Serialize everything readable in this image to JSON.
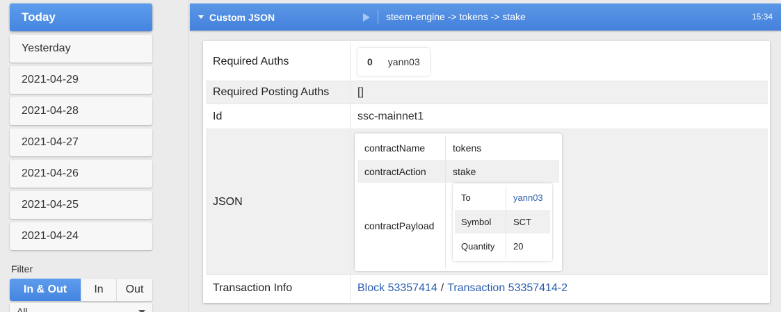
{
  "sidebar": {
    "dates": [
      "Today",
      "Yesterday",
      "2021-04-29",
      "2021-04-28",
      "2021-04-27",
      "2021-04-26",
      "2021-04-25",
      "2021-04-24"
    ],
    "filter_label": "Filter",
    "filter_options": [
      "In & Out",
      "In",
      "Out"
    ],
    "select_value": "All"
  },
  "header": {
    "title": "Custom JSON",
    "path": "steem-engine -> tokens -> stake",
    "time": "15:34"
  },
  "details": {
    "required_auths_label": "Required Auths",
    "required_auths_index": "0",
    "required_auths_value": "yann03",
    "required_posting_label": "Required Posting Auths",
    "required_posting_value": "[]",
    "id_label": "Id",
    "id_value": "ssc-mainnet1",
    "json_label": "JSON",
    "json": {
      "contract_name_key": "contractName",
      "contract_name_value": "tokens",
      "contract_action_key": "contractAction",
      "contract_action_value": "stake",
      "contract_payload_key": "contractPayload",
      "payload": {
        "to_key": "To",
        "to_value": "yann03",
        "symbol_key": "Symbol",
        "symbol_value": "SCT",
        "quantity_key": "Quantity",
        "quantity_value": "20"
      }
    },
    "tx_info_label": "Transaction Info",
    "block_link": "Block 53357414",
    "tx_separator": "/",
    "tx_link": "Transaction 53357414-2"
  },
  "colors": {
    "accent": "#4a90e2",
    "link": "#2a5db0"
  }
}
